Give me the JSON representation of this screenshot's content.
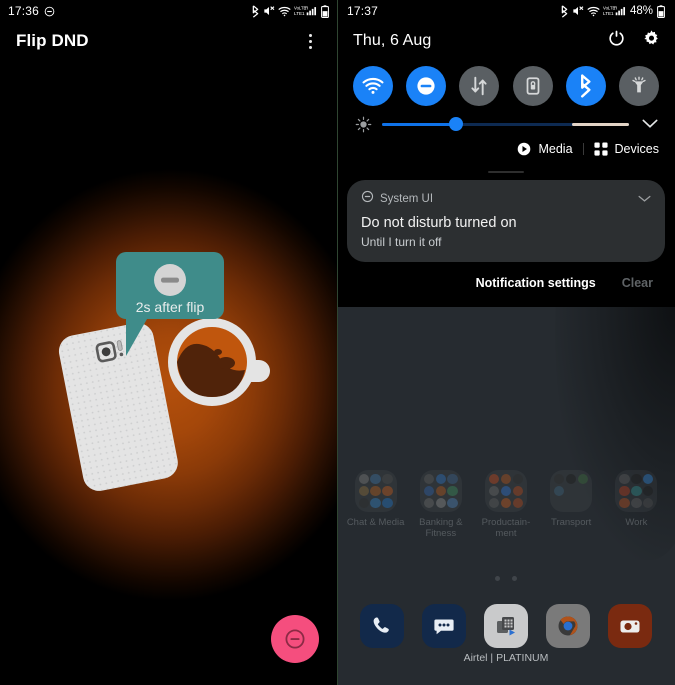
{
  "left_screen": {
    "status_bar": {
      "time": "17:36",
      "icons": [
        "dnd-icon",
        "bluetooth-icon",
        "sound-muted-icon",
        "wifi-icon",
        "volte-lte1-signal-icon",
        "battery-icon"
      ]
    },
    "app_bar": {
      "title": "Flip DND",
      "overflow_icon": "more-vertical-icon"
    },
    "illustration": {
      "tooltip_text": "2s after flip",
      "tooltip_icon": "dnd-icon",
      "tooltip_color": "#3f8c8a",
      "glow_color": "#b4500c",
      "phone_color": "#e2e2e2",
      "cup_liquid_color": "#c0560d",
      "cup_shadow_color": "#50230a",
      "elements": [
        "speech-bubble",
        "phone-face-down",
        "coffee-cup"
      ]
    },
    "fab": {
      "icon": "dnd-icon",
      "color": "#f54e7e"
    }
  },
  "right_screen": {
    "status_bar": {
      "time": "17:37",
      "battery_percent": "48%",
      "icons": [
        "bluetooth-icon",
        "sound-muted-icon",
        "wifi-icon",
        "volte-lte1-signal-icon",
        "battery-icon"
      ]
    },
    "quick_settings": {
      "date": "Thu, 6 Aug",
      "power_icon": "power-icon",
      "settings_icon": "gear-icon",
      "accent_on": "#1a82f7",
      "accent_off": "#5a5f63",
      "toggles": [
        {
          "name": "wifi",
          "icon": "wifi-icon",
          "state": "on"
        },
        {
          "name": "do-not-disturb",
          "icon": "dnd-icon",
          "state": "on"
        },
        {
          "name": "mobile-data",
          "icon": "data-arrows-icon",
          "state": "off"
        },
        {
          "name": "sim-card-lock",
          "icon": "sim-lock-icon",
          "state": "off"
        },
        {
          "name": "bluetooth",
          "icon": "bluetooth-icon",
          "state": "on"
        },
        {
          "name": "flashlight",
          "icon": "flashlight-icon",
          "state": "off"
        }
      ],
      "brightness": {
        "icon": "brightness-icon",
        "value_percent": 30,
        "expand_icon": "chevron-down-icon"
      },
      "media_label": "Media",
      "media_icon": "play-circle-icon",
      "devices_label": "Devices",
      "devices_icon": "grid-squares-icon"
    },
    "notification": {
      "app_name": "System UI",
      "app_icon": "dnd-icon",
      "expand_icon": "chevron-down-icon",
      "title": "Do not disturb turned on",
      "subtitle": "Until I turn it off",
      "actions": [
        {
          "label": "Notification settings",
          "style": "normal"
        },
        {
          "label": "Clear",
          "style": "dimmed"
        }
      ]
    },
    "home_screen": {
      "wallpaper_color": "#262b30",
      "folders": [
        {
          "label": "Chat & Media",
          "colors": [
            "#7a7a7a",
            "#3b6fa0",
            "#4a4a4a",
            "#8a6b3a",
            "#b05a1a",
            "#c0571a",
            "#2a2a2a",
            "#2e7bbf",
            "#1d6fc0"
          ]
        },
        {
          "label": "Banking & Fitness",
          "colors": [
            "#5a5a5a",
            "#2a6fbf",
            "#3a5f8a",
            "#2d5fa8",
            "#b0551a",
            "#3a8a5a",
            "#6a6a6a",
            "#8a8a8a",
            "#4a7fb5"
          ]
        },
        {
          "label": "Productain-ment",
          "colors": [
            "#c0451a",
            "#b0521a",
            "#2a2a2a",
            "#6a6a6a",
            "#2a6fd0",
            "#b0451a",
            "#5a5a5a",
            "#c0551a",
            "#b0451a"
          ]
        },
        {
          "label": "Transport",
          "colors": [
            "#2a2a2a",
            "#1a1a1a",
            "#3a6a3a",
            "#3a5f7a",
            "",
            "",
            "",
            "",
            ""
          ]
        },
        {
          "label": "Work",
          "colors": [
            "#5a5a5a",
            "#1a1a1a",
            "#2a7fd0",
            "#b03a1a",
            "#2a8a8a",
            "#1a1a1a",
            "#b04a1a",
            "#5a5a5a",
            "#4a4a4a"
          ]
        }
      ],
      "page_dots": 2,
      "dock": [
        {
          "name": "phone",
          "icon": "phone-icon",
          "bg": "#12294a",
          "fg": "#e8eef5"
        },
        {
          "name": "messages",
          "icon": "chat-bubble-icon",
          "bg": "#12294a",
          "fg": "#e8eef5"
        },
        {
          "name": "play-store-apps",
          "icon": "apps-grid-icon",
          "bg": "#c9cacb",
          "fg": "#46484a"
        },
        {
          "name": "chrome",
          "icon": "chrome-icon",
          "bg": "#7a7a7a",
          "fg": "#2a6fd0"
        },
        {
          "name": "camera",
          "icon": "camera-icon",
          "bg": "#7a2a10",
          "fg": "#ededed"
        }
      ],
      "carrier_text": "Airtel | PLATINUM"
    }
  }
}
